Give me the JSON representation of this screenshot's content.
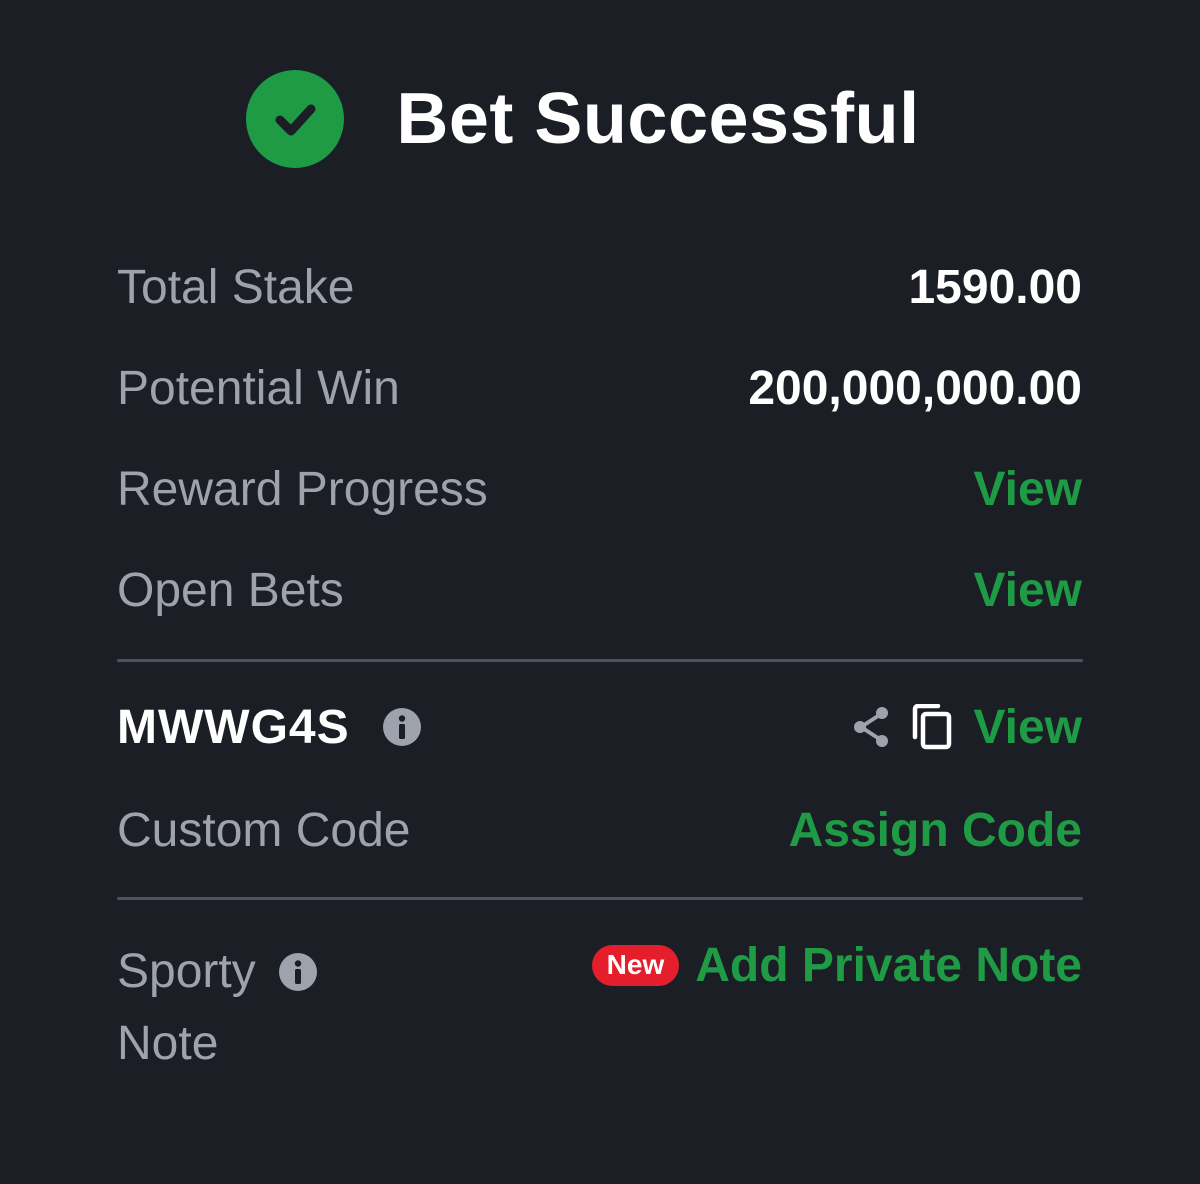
{
  "header": {
    "title": "Bet Successful"
  },
  "summary": {
    "total_stake_label": "Total Stake",
    "total_stake_value": "1590.00",
    "potential_win_label": "Potential Win",
    "potential_win_value": "200,000,000.00",
    "reward_progress_label": "Reward Progress",
    "reward_progress_link": "View",
    "open_bets_label": "Open Bets",
    "open_bets_link": "View"
  },
  "booking": {
    "code": "MWWG4S",
    "view_link": "View",
    "custom_code_label": "Custom Code",
    "assign_code_link": "Assign Code"
  },
  "note": {
    "label_line1": "Sporty",
    "label_line2": "Note",
    "badge": "New",
    "add_note_link": "Add Private Note"
  },
  "colors": {
    "background": "#1b1e25",
    "accent_green": "#1f9b45",
    "badge_red": "#e41e2a",
    "label_gray": "#9da2ad",
    "divider": "#4c5261"
  },
  "icons": {
    "success": "check-circle-icon",
    "info": "info-icon",
    "share": "share-icon",
    "copy": "copy-icon"
  }
}
